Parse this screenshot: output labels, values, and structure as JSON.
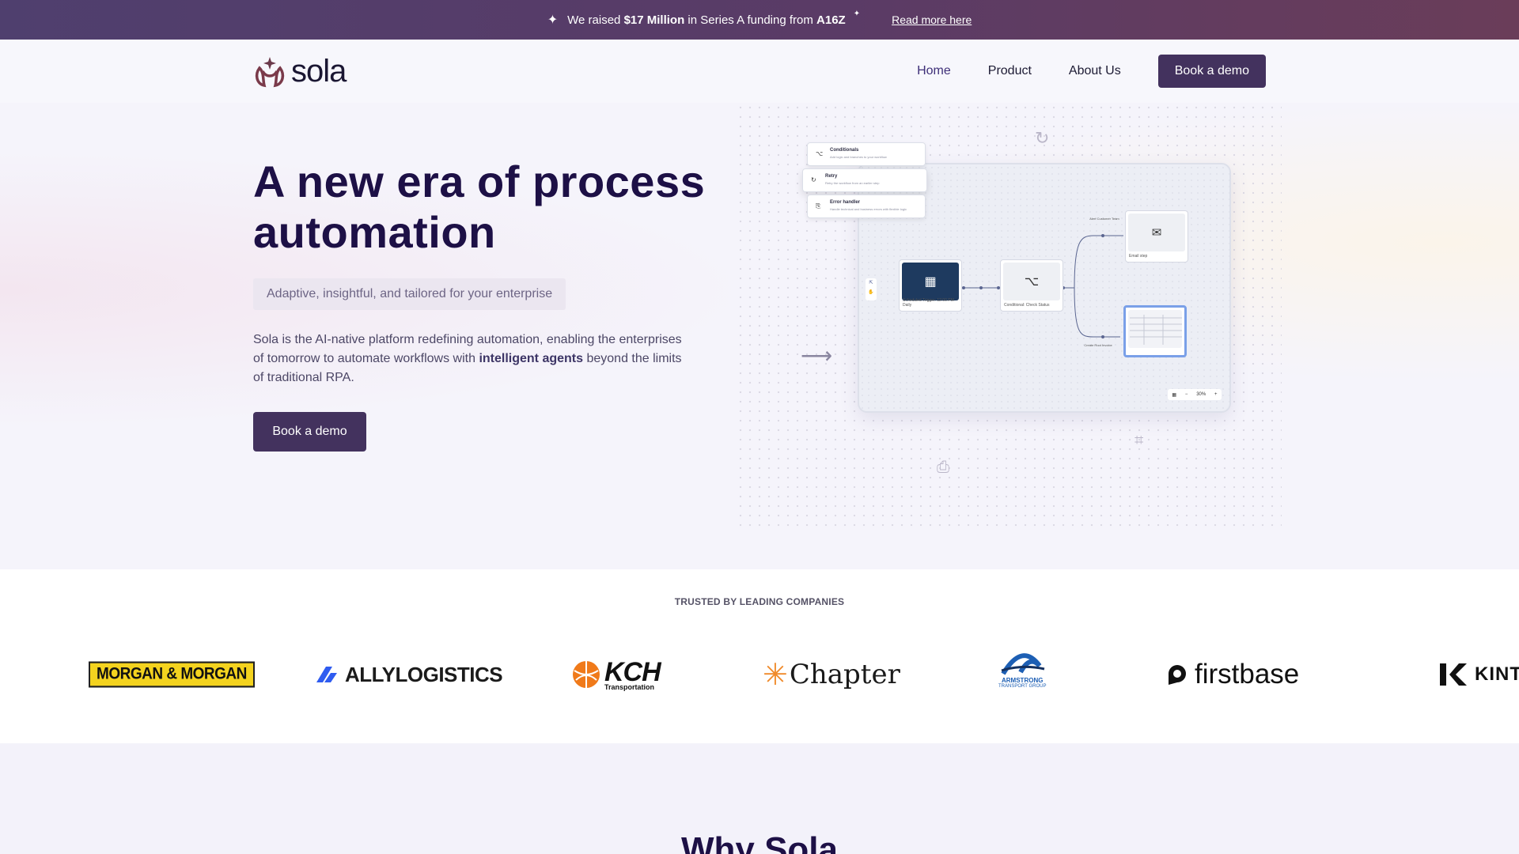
{
  "banner": {
    "text_before": "We raised",
    "amount": "$17 Million",
    "text_middle": "in Series A funding from",
    "investor": "A16Z",
    "link": "Read more here"
  },
  "header": {
    "logo_text": "sola",
    "nav": [
      {
        "label": "Home",
        "active": true
      },
      {
        "label": "Product",
        "active": false
      },
      {
        "label": "About Us",
        "active": false
      }
    ],
    "cta": "Book a demo"
  },
  "hero": {
    "title": "A new era of process automation",
    "tagline": "Adaptive, insightful, and tailored for your enterprise",
    "desc_before": "Sola is the AI-native platform redefining automation, enabling the enterprises of tomorrow to automate workflows with",
    "desc_bold": "intelligent agents",
    "desc_after": "beyond the limits of traditional RPA.",
    "cta": "Book a demo"
  },
  "illustration": {
    "menu": [
      {
        "title": "Conditionals",
        "sub": "Add logic and branches to your workflow"
      },
      {
        "title": "Retry",
        "sub": "Retry the workflow from an earlier step"
      },
      {
        "title": "Error handler",
        "sub": "Handle technical and business errors with flexible logic"
      }
    ],
    "nodes": {
      "trigger": "Scheduled Trigger: 12:00 PM Daily",
      "conditional": "Conditional: Check Status",
      "email": "Email step",
      "branch_top": "Alert Customer Team",
      "branch_bottom": "Create Root Invoice"
    },
    "zoom": "30%"
  },
  "trusted": {
    "label": "TRUSTED BY LEADING COMPANIES",
    "logos": {
      "morgan": "MORGAN & MORGAN",
      "ally": "ALLYLOGISTICS",
      "kch": "KCH",
      "kch_sub": "Transportation",
      "chapter": "Chapter",
      "armstrong_line1": "ARMSTRONG",
      "armstrong_line2": "TRANSPORT GROUP",
      "firstbase": "firstbase",
      "kints": "KINTS"
    }
  },
  "why": {
    "title": "Why Sola"
  },
  "colors": {
    "brand": "#43325e",
    "heading": "#1d1046",
    "banner_start": "#4f3f6e",
    "banner_end": "#6a3d59"
  }
}
